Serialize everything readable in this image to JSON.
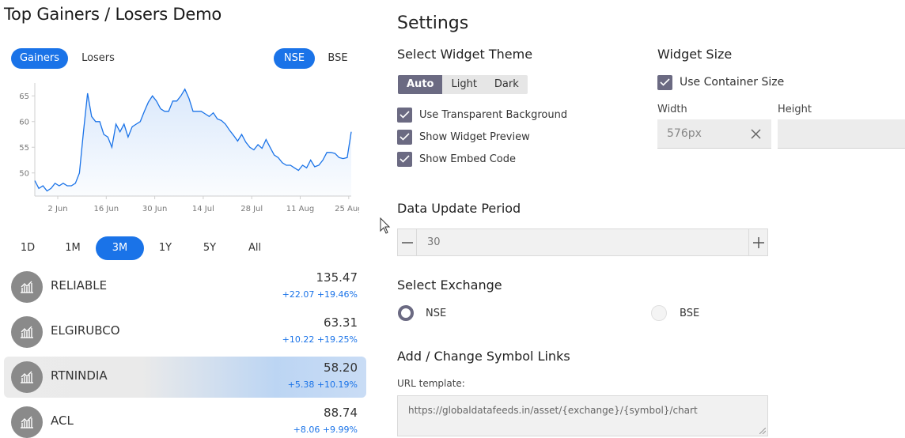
{
  "title": "Top Gainers / Losers Demo",
  "tabs": {
    "gainers": "Gainers",
    "losers": "Losers"
  },
  "exchange_tabs": {
    "nse": "NSE",
    "bse": "BSE"
  },
  "chart_data": {
    "type": "area",
    "x_ticks": [
      "2 Jun",
      "16 Jun",
      "30 Jun",
      "14 Jul",
      "28 Jul",
      "11 Aug",
      "25 Aug"
    ],
    "y_ticks": [
      65,
      60,
      55,
      50
    ],
    "ylim": [
      45.5,
      67.5
    ],
    "color": "#1a73e8",
    "series": [
      {
        "values": [
          48.5,
          47,
          47.5,
          46.5,
          47,
          48,
          47.5,
          48,
          47.5,
          47.5,
          48,
          50,
          58,
          65.5,
          61,
          60,
          60,
          57.5,
          57,
          55,
          59.5,
          58,
          59.5,
          57,
          59,
          59.5,
          60,
          62,
          63.8,
          65,
          64,
          62.5,
          62,
          62,
          64,
          64,
          65,
          66.3,
          64.5,
          62,
          62,
          62,
          61.5,
          61,
          61.7,
          60.5,
          60.2,
          59.5,
          58.3,
          57.3,
          56.2,
          57.5,
          56,
          55,
          54.5,
          55.5,
          54.8,
          56.5,
          55,
          53.5,
          53,
          52,
          51.5,
          51.5,
          51,
          50.5,
          51.5,
          51,
          52.5,
          51.2,
          51.5,
          52.5,
          54,
          54,
          53.8,
          53,
          52.8,
          53,
          58
        ]
      }
    ]
  },
  "ranges": [
    "1D",
    "1M",
    "3M",
    "1Y",
    "5Y",
    "All"
  ],
  "active_range": "3M",
  "stocks": [
    {
      "symbol": "RELIABLE",
      "price": "135.47",
      "change": "+22.07 +19.46%"
    },
    {
      "symbol": "ELGIRUBCO",
      "price": "63.31",
      "change": "+10.22 +19.25%"
    },
    {
      "symbol": "RTNINDIA",
      "price": "58.20",
      "change": "+5.38 +10.19%"
    },
    {
      "symbol": "ACL",
      "price": "88.74",
      "change": "+8.06 +9.99%"
    }
  ],
  "settings": {
    "heading": "Settings",
    "theme_heading": "Select Widget Theme",
    "theme_options": {
      "auto": "Auto",
      "light": "Light",
      "dark": "Dark"
    },
    "checkboxes": {
      "transparent": "Use Transparent Background",
      "preview": "Show Widget Preview",
      "embed": "Show Embed Code"
    },
    "size_heading": "Widget Size",
    "container_size": "Use Container Size",
    "width_label": "Width",
    "height_label": "Height",
    "width_value": "576px",
    "period_heading": "Data Update Period",
    "period_value": "30",
    "exchange_heading": "Select Exchange",
    "exchange_nse": "NSE",
    "exchange_bse": "BSE",
    "links_heading": "Add / Change Symbol Links",
    "url_label": "URL template:",
    "url_value": "https://globaldatafeeds.in/asset/{exchange}/{symbol}/chart"
  }
}
